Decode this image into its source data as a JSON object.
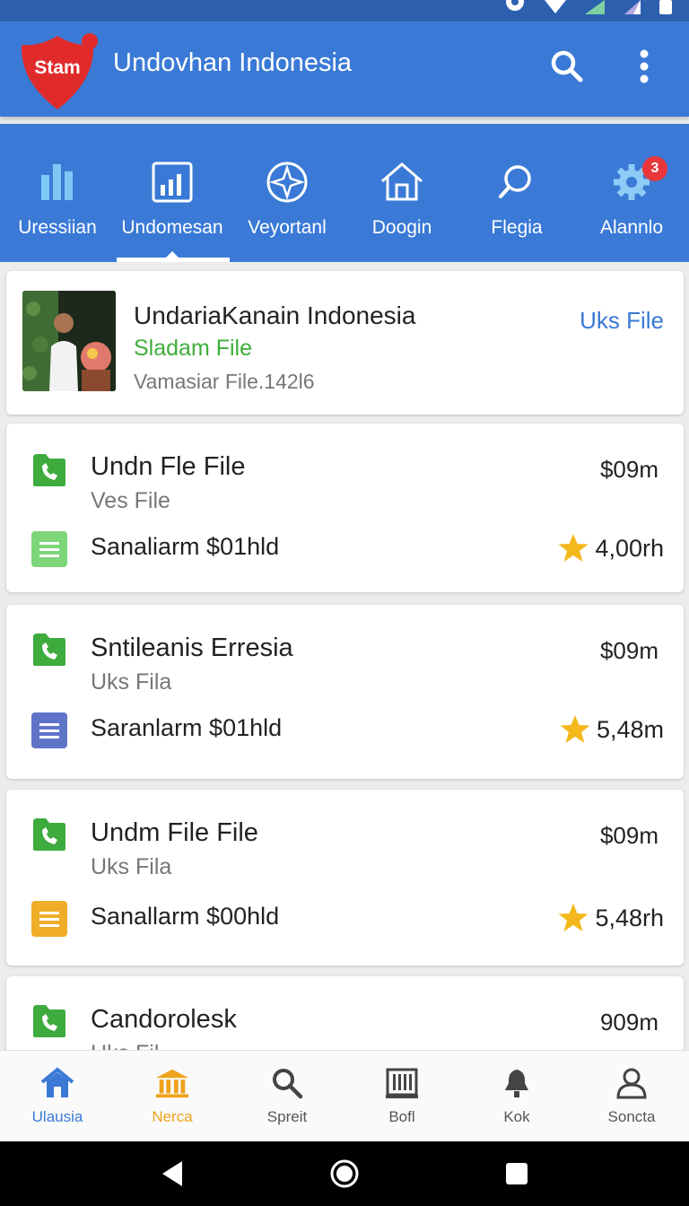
{
  "app": {
    "logo_text": "Stam",
    "title": "Undovhan Indonesia"
  },
  "tabs": [
    {
      "label": "Uressiian",
      "icon": "bars-icon",
      "active": false
    },
    {
      "label": "Undomesan",
      "icon": "chart-icon",
      "active": true
    },
    {
      "label": "Veyortanl",
      "icon": "compass-icon",
      "active": false
    },
    {
      "label": "Doogin",
      "icon": "home-icon",
      "active": false
    },
    {
      "label": "Flegia",
      "icon": "search-icon",
      "active": false
    },
    {
      "label": "Alannlo",
      "icon": "gear-icon",
      "active": false,
      "badge": "3"
    }
  ],
  "profile": {
    "name": "UndariaKanain Indonesia",
    "subtitle": "Sladam File",
    "meta": "Vamasiar File.142l6",
    "link": "Uks File"
  },
  "items": [
    {
      "title": "Undn Fle File",
      "sub": "Ves File",
      "price": "$09m",
      "line2": "Sanaliarm $01hld",
      "rating": "4,00rh",
      "line_icon_color": "#7ed67a"
    },
    {
      "title": "Sntileanis Erresia",
      "sub": "Uks Fila",
      "price": "$09m",
      "line2": "Saranlarm $01hld",
      "rating": "5,48m",
      "line_icon_color": "#5f74c9"
    },
    {
      "title": "Undm File File",
      "sub": "Uks Fila",
      "price": "$09m",
      "line2": "Sanallarm $00hld",
      "rating": "5,48rh",
      "line_icon_color": "#efad28"
    },
    {
      "title": "Candorolesk",
      "sub": "Uks Fil",
      "price": "909m",
      "line2": "",
      "rating": "",
      "line_icon_color": "#7ed67a"
    }
  ],
  "bottom_nav": [
    {
      "label": "Ulausia",
      "icon": "home-icon",
      "color": "#3a7ad6"
    },
    {
      "label": "Nerca",
      "icon": "bank-icon",
      "color": "#efa21b"
    },
    {
      "label": "Spreit",
      "icon": "search-icon",
      "color": "#555555"
    },
    {
      "label": "Bofl",
      "icon": "building-icon",
      "color": "#555555"
    },
    {
      "label": "Kok",
      "icon": "bell-icon",
      "color": "#555555"
    },
    {
      "label": "Soncta",
      "icon": "person-icon",
      "color": "#555555"
    }
  ],
  "colors": {
    "primary": "#3a7ad6",
    "accent_green": "#3eae3a",
    "logo_red": "#e12b2b",
    "star": "#f5b81c"
  }
}
